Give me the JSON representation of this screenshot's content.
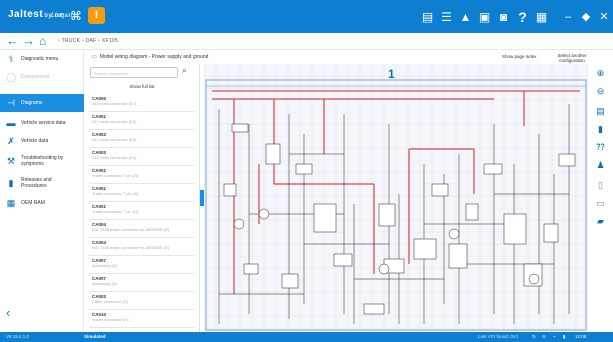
{
  "app": {
    "logo_text": "Jaltest",
    "logo_sub": "by cojali",
    "live_label": "Live",
    "warning_label": "!",
    "top_icons": [
      "document-icon",
      "list-icon",
      "car-icon",
      "bus-icon",
      "camera-icon",
      "help-icon",
      "grid-icon"
    ],
    "help_label": "?",
    "window_minimize": "–",
    "window_maximize": "◆",
    "window_close": "✕"
  },
  "nav": {
    "back": "←",
    "forward": "→",
    "home": "⌂",
    "breadcrumb": "›  TRUCK  ›  DAF  ›  XF105"
  },
  "sidebar": {
    "items": [
      {
        "label": "Diagnostic menu",
        "icon": "stethoscope-icon",
        "glyph": "⚕",
        "state": "normal"
      },
      {
        "label": "Components",
        "icon": "component-icon",
        "glyph": "◯",
        "state": "blurred"
      },
      {
        "label": "Diagrams",
        "icon": "diagram-icon",
        "glyph": "⊣",
        "state": "active"
      },
      {
        "label": "Vehicle service data",
        "icon": "truck-icon",
        "glyph": "▬",
        "state": "normal"
      },
      {
        "label": "Vehicle data",
        "icon": "wrench-icon",
        "glyph": "✗",
        "state": "normal"
      },
      {
        "label": "Troubleshooting by symptoms",
        "icon": "troubleshoot-icon",
        "glyph": "⚒",
        "state": "normal"
      },
      {
        "label": "Releases and Procedures",
        "icon": "procedures-icon",
        "glyph": "▮",
        "state": "normal"
      },
      {
        "label": "OEM RAM",
        "icon": "oem-icon",
        "glyph": "▦",
        "state": "normal"
      }
    ],
    "collapse": "‹"
  },
  "diagram_header": {
    "title": "Model wiring diagram - Power supply and ground",
    "show_page_index": "Show page index",
    "select_another": "Select another configuration"
  },
  "component_list": {
    "search_placeholder": "Search component",
    "show_full_list": "Show full list",
    "items": [
      {
        "code": "CA000",
        "desc": "24V main connector (D1)"
      },
      {
        "code": "CA001",
        "desc": "24V main connector (D2)"
      },
      {
        "code": "CA002",
        "desc": "24V main connector (D3)"
      },
      {
        "code": "CA003",
        "desc": "24V main connector (D4)"
      },
      {
        "code": "CA001",
        "desc": "Trailer connector 7 pin (D)"
      },
      {
        "code": "CA001",
        "desc": "Trailer connector 7 pin (A)"
      },
      {
        "code": "CA001",
        "desc": "Trailer connector 7 pin (D)"
      },
      {
        "code": "CA004",
        "desc": "ISO 7638 trailer connector for ABS/EBS (D)"
      },
      {
        "code": "CA004",
        "desc": "ISO 7638 trailer connector for ABS/EBS (D)"
      },
      {
        "code": "CA007",
        "desc": "Accessory (D)"
      },
      {
        "code": "CA007",
        "desc": "Accessory (D)"
      },
      {
        "code": "CA003",
        "desc": "Cabin connector (D)"
      },
      {
        "code": "CA010",
        "desc": "Trailer connector (D)"
      }
    ]
  },
  "diagram": {
    "page_number": "1",
    "colors": {
      "red_wire": "#d42020",
      "black_wire": "#222222",
      "grid": "#c9d6ea",
      "frame": "#6a8fc4"
    }
  },
  "right_tools": [
    {
      "icon": "zoom-in-icon",
      "glyph": "⊕"
    },
    {
      "icon": "zoom-out-icon",
      "glyph": "⊖"
    },
    {
      "icon": "document-icon",
      "glyph": "▤"
    },
    {
      "icon": "battery-icon",
      "glyph": "▮"
    },
    {
      "icon": "fuse-icon",
      "glyph": "⁇"
    },
    {
      "icon": "people-icon",
      "glyph": "♟"
    },
    {
      "icon": "file-icon",
      "glyph": "▯"
    },
    {
      "icon": "layers-icon",
      "glyph": "▭"
    },
    {
      "icon": "note-icon",
      "glyph": "▰"
    }
  ],
  "statusbar": {
    "version": "V8   19.4.1.0",
    "mode": "Simulated",
    "version_info": "Last VCI found: 0V1",
    "time": "12:08",
    "icons": [
      "sync-icon",
      "wifi-icon",
      "usb-icon",
      "battery-status-icon"
    ]
  }
}
